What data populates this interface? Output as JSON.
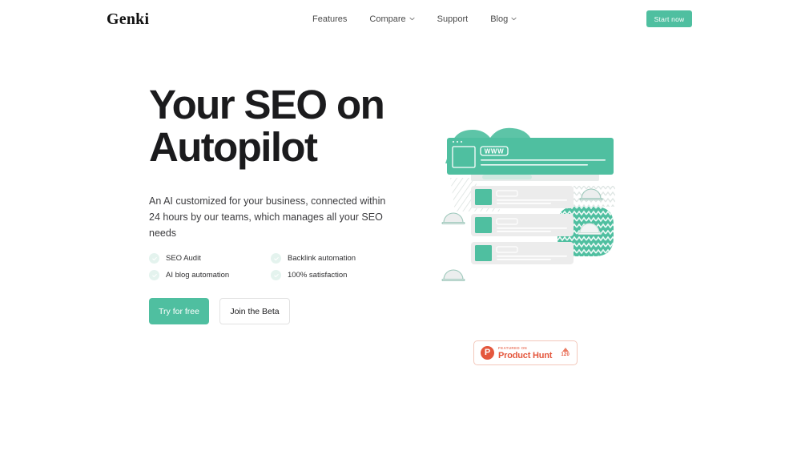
{
  "brand": {
    "logo_text": "Genki",
    "accent_color": "#4fbfa0",
    "accent_light": "#e4f3ee",
    "text_color": "#1b1b1d",
    "producthunt_color": "#e4573d"
  },
  "header": {
    "nav_items": [
      {
        "label": "Features",
        "has_dropdown": false,
        "icon": ""
      },
      {
        "label": "Compare",
        "has_dropdown": true,
        "icon": "chevron-down-icon"
      },
      {
        "label": "Support",
        "has_dropdown": false,
        "icon": ""
      },
      {
        "label": "Blog",
        "has_dropdown": true,
        "icon": "chevron-down-icon"
      }
    ],
    "cta_label": "Start now"
  },
  "hero": {
    "title": "Your SEO on\nAutopilot",
    "subtitle": "An AI customized for your business, connected within 24 hours by our teams, which manages all your SEO needs",
    "features": [
      {
        "label": "SEO Audit",
        "icon": "check-circle-icon"
      },
      {
        "label": "Backlink automation",
        "icon": "check-circle-icon"
      },
      {
        "label": "AI blog automation",
        "icon": "check-circle-icon"
      },
      {
        "label": "100% satisfaction",
        "icon": "check-circle-icon"
      }
    ],
    "primary_cta": "Try for free",
    "secondary_cta": "Join the Beta",
    "illustration": {
      "browser_badge": "WWW",
      "icon": "seo-dashboard-illustration"
    }
  },
  "product_hunt": {
    "kicker": "FEATURED ON",
    "name": "Product Hunt",
    "upvotes": "120",
    "logo_letter": "P",
    "upvote_icon": "upvote-triangle-icon"
  }
}
